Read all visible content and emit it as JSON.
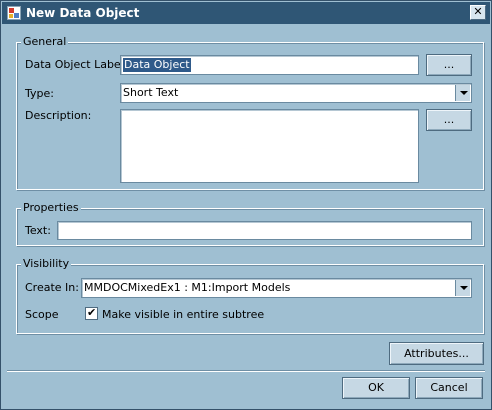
{
  "window": {
    "title": "New Data Object",
    "icon": "data-object-icon"
  },
  "general": {
    "legend": "General",
    "label_field": {
      "label": "Data Object Label:",
      "value": "Data Object",
      "browse_label": "..."
    },
    "type_field": {
      "label": "Type:",
      "value": "Short Text"
    },
    "description_field": {
      "label": "Description:",
      "value": "",
      "browse_label": "..."
    }
  },
  "properties": {
    "legend": "Properties",
    "text_field": {
      "label": "Text:",
      "value": ""
    }
  },
  "visibility": {
    "legend": "Visibility",
    "create_in": {
      "label": "Create In:",
      "value": "MMDOCMixedEx1 : M1:Import Models"
    },
    "scope": {
      "label": "Scope",
      "checkbox_label": "Make visible in entire subtree",
      "checked": true
    }
  },
  "buttons": {
    "attributes": "Attributes...",
    "ok": "OK",
    "cancel": "Cancel"
  }
}
